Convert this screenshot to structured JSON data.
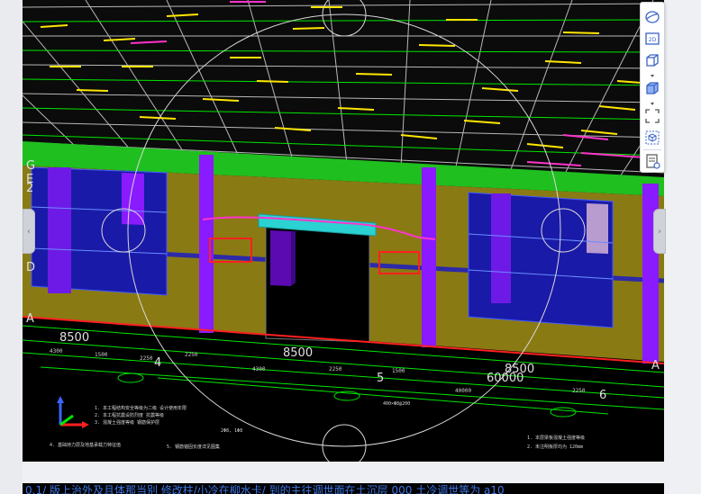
{
  "viewport": {
    "background": "#000000",
    "axis_labels": {
      "left": [
        "G",
        "E",
        "2",
        "D",
        "A"
      ],
      "right": "A"
    },
    "grid_numbers": [
      "4",
      "5",
      "6"
    ],
    "dimensions": [
      "8500",
      "8500",
      "8500",
      "60000"
    ],
    "colors": {
      "slab_grid": "#b8b8b8",
      "rebar_yellow": "#ffe600",
      "rebar_green": "#00e600",
      "beam_green": "#1fbf1f",
      "wall_olive": "#8a7a14",
      "column_purple": "#8a1aff",
      "window_blue": "#1a1aa8",
      "selection_red": "#ff2020",
      "lintel_cyan": "#2ad2d2",
      "path_magenta": "#ff33cc"
    }
  },
  "toolbar": {
    "buttons": [
      {
        "name": "orbit",
        "icon": "orbit-icon"
      },
      {
        "name": "2d",
        "icon": "view-2d-icon",
        "label": "2D"
      },
      {
        "name": "3d-view",
        "icon": "cube-3d-icon"
      },
      {
        "name": "display-mode",
        "icon": "solid-cube-icon"
      },
      {
        "name": "fit",
        "icon": "fullscreen-icon"
      },
      {
        "name": "dynamic-observe",
        "icon": "box-select-icon"
      },
      {
        "name": "properties",
        "icon": "property-list-icon"
      }
    ]
  },
  "status_bar": {
    "text": "0.1/ 版上治外及且体那当别 修改柱/小冷在柳水卡/ 到的主往调世面在土沉层 000 土冷调世等为 a10"
  }
}
